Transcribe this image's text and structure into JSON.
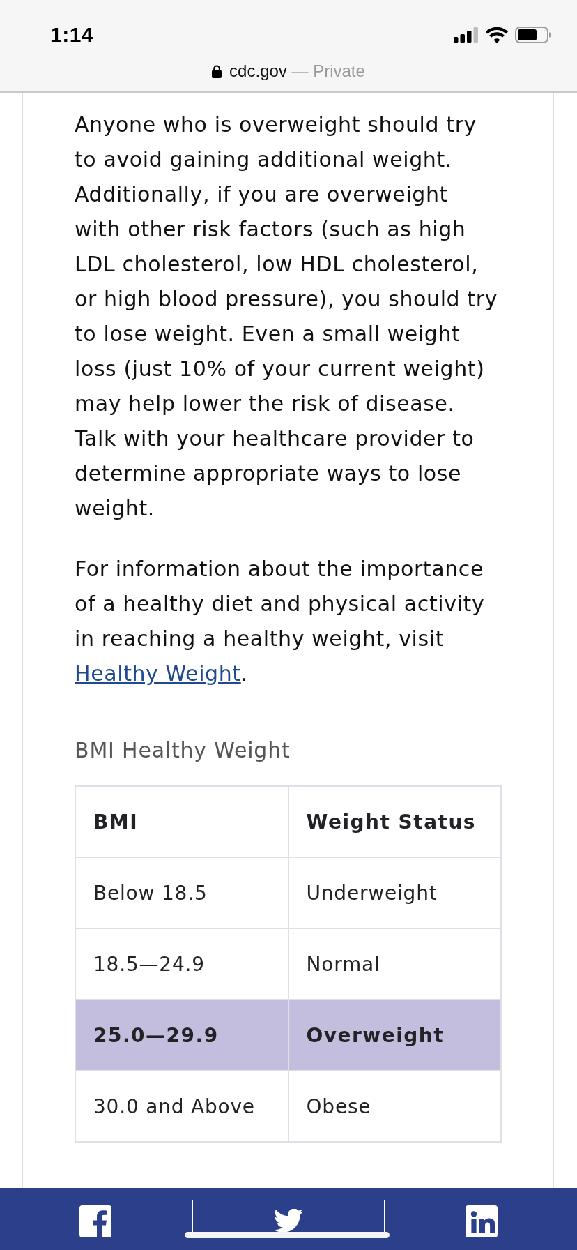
{
  "status_bar": {
    "time": "1:14"
  },
  "address_bar": {
    "domain": "cdc.gov",
    "note": "— Private"
  },
  "article": {
    "paragraphs": [
      {
        "text": "Anyone who is overweight should try to avoid gaining additional weight. Additionally, if you are overweight with other risk factors (such as high LDL cholesterol, low HDL cholesterol, or high blood pressure), you should try to lose weight. Even a small weight loss (just 10% of your current weight) may help lower the risk of disease. Talk with your healthcare provider to determine appropriate ways to lose weight."
      },
      {
        "text": "For information about the importance of a healthy diet and physical activity in reaching a healthy weight, visit",
        "link": "Healthy Weight",
        "after": "."
      }
    ]
  },
  "table": {
    "caption": "BMI Healthy Weight",
    "columns": [
      "BMI",
      "Weight Status"
    ],
    "rows": [
      {
        "cells": [
          "Below 18.5",
          "Underweight"
        ],
        "highlighted": false
      },
      {
        "cells": [
          "18.5—24.9",
          "Normal"
        ],
        "highlighted": false
      },
      {
        "cells": [
          "25.0—29.9",
          "Overweight"
        ],
        "highlighted": true
      },
      {
        "cells": [
          "30.0 and Above",
          "Obese"
        ],
        "highlighted": false
      }
    ]
  }
}
